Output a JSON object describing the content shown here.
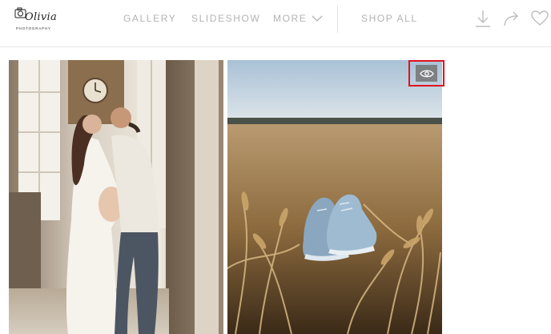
{
  "brand": {
    "name": "Olivia",
    "subtitle": "PHOTOGRAPHY"
  },
  "nav": {
    "gallery": "GALLERY",
    "slideshow": "SLIDESHOW",
    "more": "MORE",
    "shop_all": "SHOP ALL"
  },
  "toolbar": {
    "download_icon": "download-icon",
    "share_icon": "share-icon",
    "favorite_icon": "heart-icon"
  },
  "photos": [
    {
      "subject": "couple-maternity"
    },
    {
      "subject": "baby-shoes-wheat-field"
    }
  ],
  "overlay": {
    "view_icon": "eye-icon",
    "highlight_color": "#e0121f"
  },
  "colors": {
    "nav_text": "#b3b3b3",
    "divider": "#e6e6e6"
  }
}
